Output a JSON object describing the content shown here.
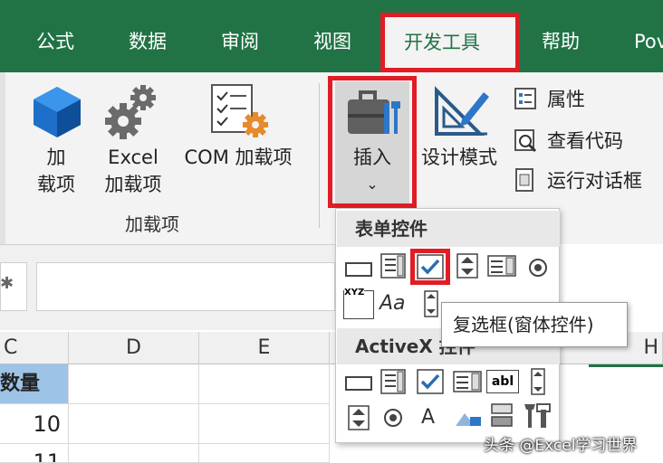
{
  "ribbon_tabs": [
    {
      "label": "公式"
    },
    {
      "label": "数据"
    },
    {
      "label": "审阅"
    },
    {
      "label": "视图"
    },
    {
      "label": "开发工具",
      "active": true
    },
    {
      "label": "帮助"
    },
    {
      "label": "Pov"
    }
  ],
  "addins_group": {
    "btn_addin_line1": "加",
    "btn_addin_line2": "载项",
    "btn_excel_line1": "Excel",
    "btn_excel_line2": "加载项",
    "btn_com": "COM 加载项",
    "label": "加载项"
  },
  "controls_group": {
    "insert_label": "插入",
    "insert_arrow": "⌄",
    "design_mode": "设计模式",
    "properties": "属性",
    "view_code": "查看代码",
    "run_dialog": "运行对话框"
  },
  "grid": {
    "columns": [
      "C",
      "D",
      "E",
      "H"
    ],
    "header_cell": "数量",
    "row_values": [
      "10",
      "11"
    ]
  },
  "insert_dropdown": {
    "form_controls_header": "表单控件",
    "activex_header": "ActiveX 控件",
    "tooltip": "复选框(窗体控件)",
    "label_aa": "Aa",
    "label_xyz": "XYZ",
    "label_a": "A",
    "label_abl": "abl"
  },
  "watermark": "头条 @Excel学习世界",
  "colors": {
    "ribbon_green": "#217346",
    "highlight_red": "#e11c24",
    "header_blue": "#9dc3e6",
    "checkbox_blue": "#2b6cb0"
  }
}
